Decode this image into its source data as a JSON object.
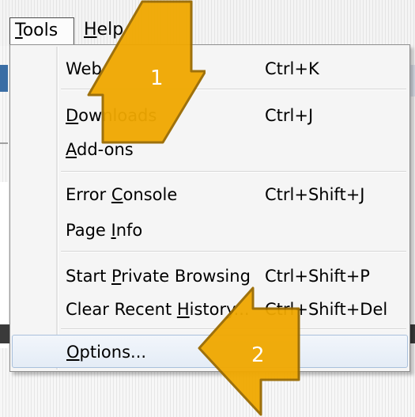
{
  "menubar": {
    "tools": {
      "label_pre": "",
      "label_u": "T",
      "label_post": "ools"
    },
    "help": {
      "label_u": "H",
      "label_post": "elp"
    }
  },
  "menu": {
    "items": [
      {
        "lbl_pre": "Web",
        "lbl_u": "",
        "lbl_post": "",
        "shortcut": "Ctrl+K"
      },
      {
        "lbl_pre": "",
        "lbl_u": "D",
        "lbl_post": "ownloads",
        "shortcut": "Ctrl+J"
      },
      {
        "lbl_pre": "",
        "lbl_u": "A",
        "lbl_post": "dd-ons",
        "shortcut": ""
      },
      {
        "lbl_pre": "Error ",
        "lbl_u": "C",
        "lbl_post": "onsole",
        "shortcut": "Ctrl+Shift+J"
      },
      {
        "lbl_pre": "Page ",
        "lbl_u": "I",
        "lbl_post": "nfo",
        "shortcut": ""
      },
      {
        "lbl_pre": "Start ",
        "lbl_u": "P",
        "lbl_post": "rivate Browsing",
        "shortcut": "Ctrl+Shift+P"
      },
      {
        "lbl_pre": "Clear Recent ",
        "lbl_u": "H",
        "lbl_post": "istory...",
        "shortcut": "Ctrl+Shift+Del"
      },
      {
        "lbl_pre": "",
        "lbl_u": "O",
        "lbl_post": "ptions...",
        "shortcut": ""
      }
    ]
  },
  "callouts": {
    "step1": "1",
    "step2": "2",
    "color": "#f0a800"
  }
}
